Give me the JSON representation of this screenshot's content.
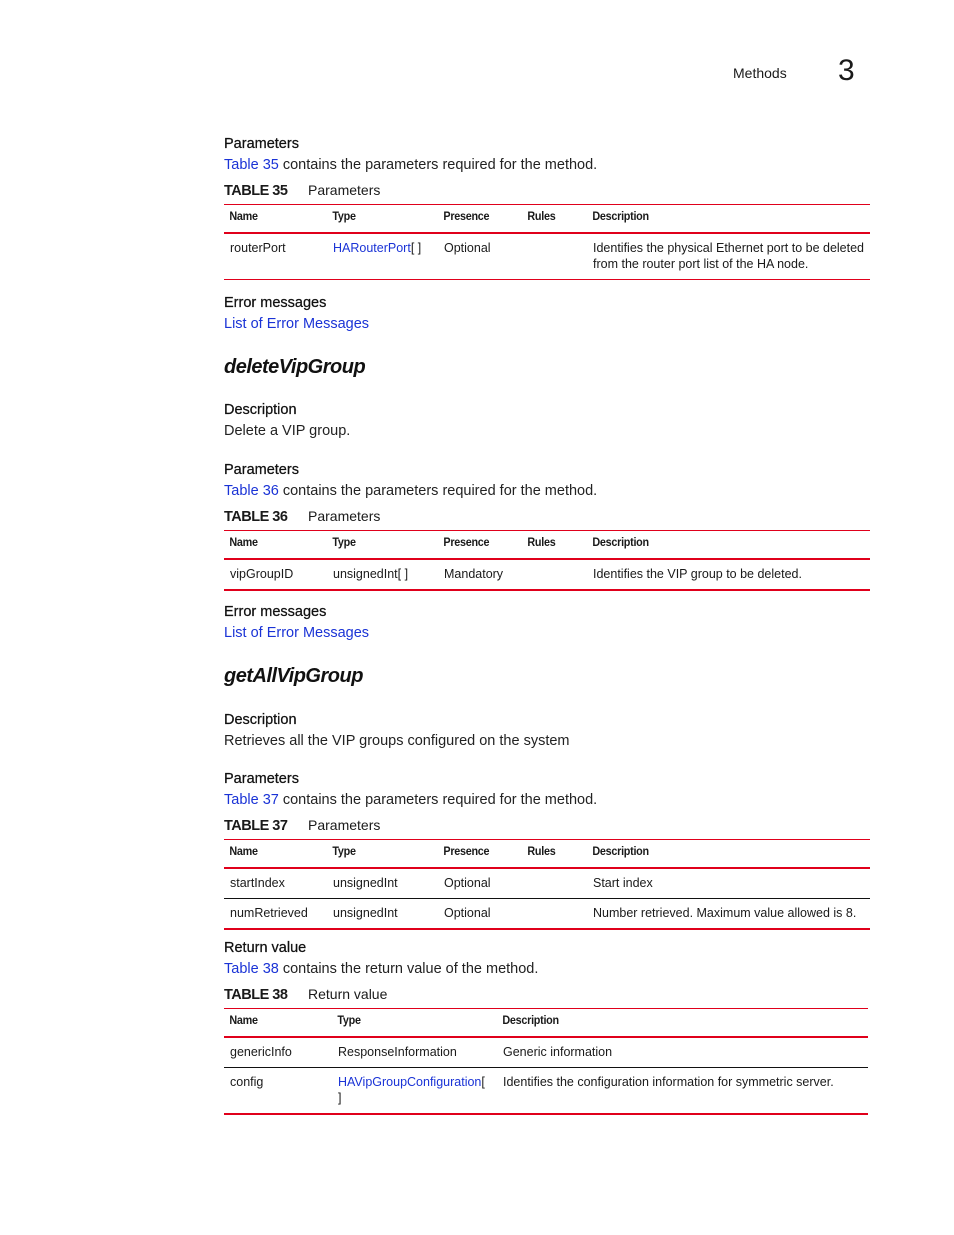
{
  "header": {
    "section": "Methods",
    "chapter": "3"
  },
  "block1": {
    "params_heading": "Parameters",
    "params_link": "Table 35",
    "params_text": " contains the parameters required for the method.",
    "table_label": "TABLE 35",
    "table_title": "Parameters",
    "columns": [
      "Name",
      "Type",
      "Presence",
      "Rules",
      "Description"
    ],
    "rows": [
      {
        "name": "routerPort",
        "type_link": "HARouterPort",
        "type_suffix": "[ ]",
        "presence": "Optional",
        "rules": "",
        "description": "Identifies the physical Ethernet port to be deleted from the router port list of the HA node."
      }
    ],
    "errors_heading": "Error messages",
    "errors_link": "List of Error Messages"
  },
  "deleteVipGroup": {
    "title": "deleteVipGroup",
    "desc_heading": "Description",
    "desc_text": "Delete a VIP group.",
    "params_heading": "Parameters",
    "params_link": "Table 36",
    "params_text": " contains the parameters required for the method.",
    "table_label": "TABLE 36",
    "table_title": "Parameters",
    "columns": [
      "Name",
      "Type",
      "Presence",
      "Rules",
      "Description"
    ],
    "rows": [
      {
        "name": "vipGroupID",
        "type": "unsignedInt[ ]",
        "presence": "Mandatory",
        "rules": "",
        "description": "Identifies the VIP group to be deleted."
      }
    ],
    "errors_heading": "Error messages",
    "errors_link": "List of Error Messages"
  },
  "getAllVipGroup": {
    "title": "getAllVipGroup",
    "desc_heading": "Description",
    "desc_text": "Retrieves all the VIP groups configured on the system",
    "params_heading": "Parameters",
    "params_link": "Table 37",
    "params_text": " contains the parameters required for the method.",
    "table_label": "TABLE 37",
    "table_title": "Parameters",
    "columns": [
      "Name",
      "Type",
      "Presence",
      "Rules",
      "Description"
    ],
    "rows": [
      {
        "name": "startIndex",
        "type": "unsignedInt",
        "presence": "Optional",
        "rules": "",
        "description": "Start index"
      },
      {
        "name": "numRetrieved",
        "type": "unsignedInt",
        "presence": "Optional",
        "rules": "",
        "description": "Number retrieved. Maximum value allowed is 8."
      }
    ],
    "return_heading": "Return value",
    "return_link": "Table 38",
    "return_text": " contains the return value of the method.",
    "rt_label": "TABLE 38",
    "rt_title": "Return value",
    "rt_columns": [
      "Name",
      "Type",
      "Description"
    ],
    "rt_rows": [
      {
        "name": "genericInfo",
        "type": "ResponseInformation",
        "description": "Generic information"
      },
      {
        "name": "config",
        "type_link": "HAVipGroupConfiguration",
        "type_suffix": "[ ]",
        "description": "Identifies the configuration information for symmetric server."
      }
    ]
  },
  "colors": {
    "link": "#1a33d6",
    "rule_red": "#e0001b"
  }
}
